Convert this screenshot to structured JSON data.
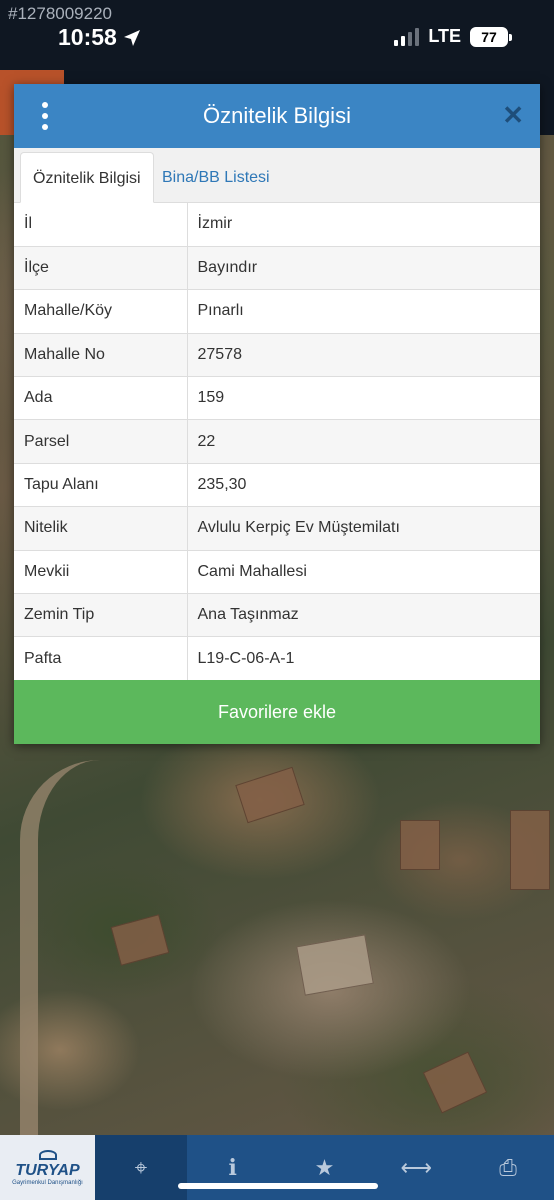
{
  "status_bar": {
    "screenshot_id": "#1278009220",
    "time": "10:58",
    "network": "LTE",
    "battery": "77"
  },
  "panel": {
    "title": "Öznitelik Bilgisi",
    "tabs": [
      {
        "label": "Öznitelik Bilgisi",
        "active": true
      },
      {
        "label": "Bina/BB Listesi",
        "active": false
      }
    ],
    "rows": [
      {
        "key": "İl",
        "value": "İzmir"
      },
      {
        "key": "İlçe",
        "value": "Bayındır"
      },
      {
        "key": "Mahalle/Köy",
        "value": "Pınarlı"
      },
      {
        "key": "Mahalle No",
        "value": "27578"
      },
      {
        "key": "Ada",
        "value": "159"
      },
      {
        "key": "Parsel",
        "value": "22"
      },
      {
        "key": "Tapu Alanı",
        "value": "235,30"
      },
      {
        "key": "Nitelik",
        "value": "Avlulu Kerpiç Ev Müştemilatı"
      },
      {
        "key": "Mevkii",
        "value": "Cami Mahallesi"
      },
      {
        "key": "Zemin Tip",
        "value": "Ana Taşınmaz"
      },
      {
        "key": "Pafta",
        "value": "L19-C-06-A-1"
      }
    ],
    "favorite_button": "Favorilere ekle"
  },
  "toolbar": {
    "logo_text": "TURYAP",
    "logo_sub": "Gayrimenkul Danışmanlığı",
    "buttons": [
      {
        "icon": "crosshair-icon",
        "glyph": "⌖",
        "active": true
      },
      {
        "icon": "info-icon",
        "glyph": "i",
        "active": false
      },
      {
        "icon": "star-icon",
        "glyph": "★",
        "active": false
      },
      {
        "icon": "measure-icon",
        "glyph": "⟷",
        "active": false
      },
      {
        "icon": "print-icon",
        "glyph": "⎙",
        "active": false
      }
    ]
  },
  "colors": {
    "header": "#3b85c4",
    "favorite": "#5cb85c",
    "toolbar": "#1f5187"
  }
}
